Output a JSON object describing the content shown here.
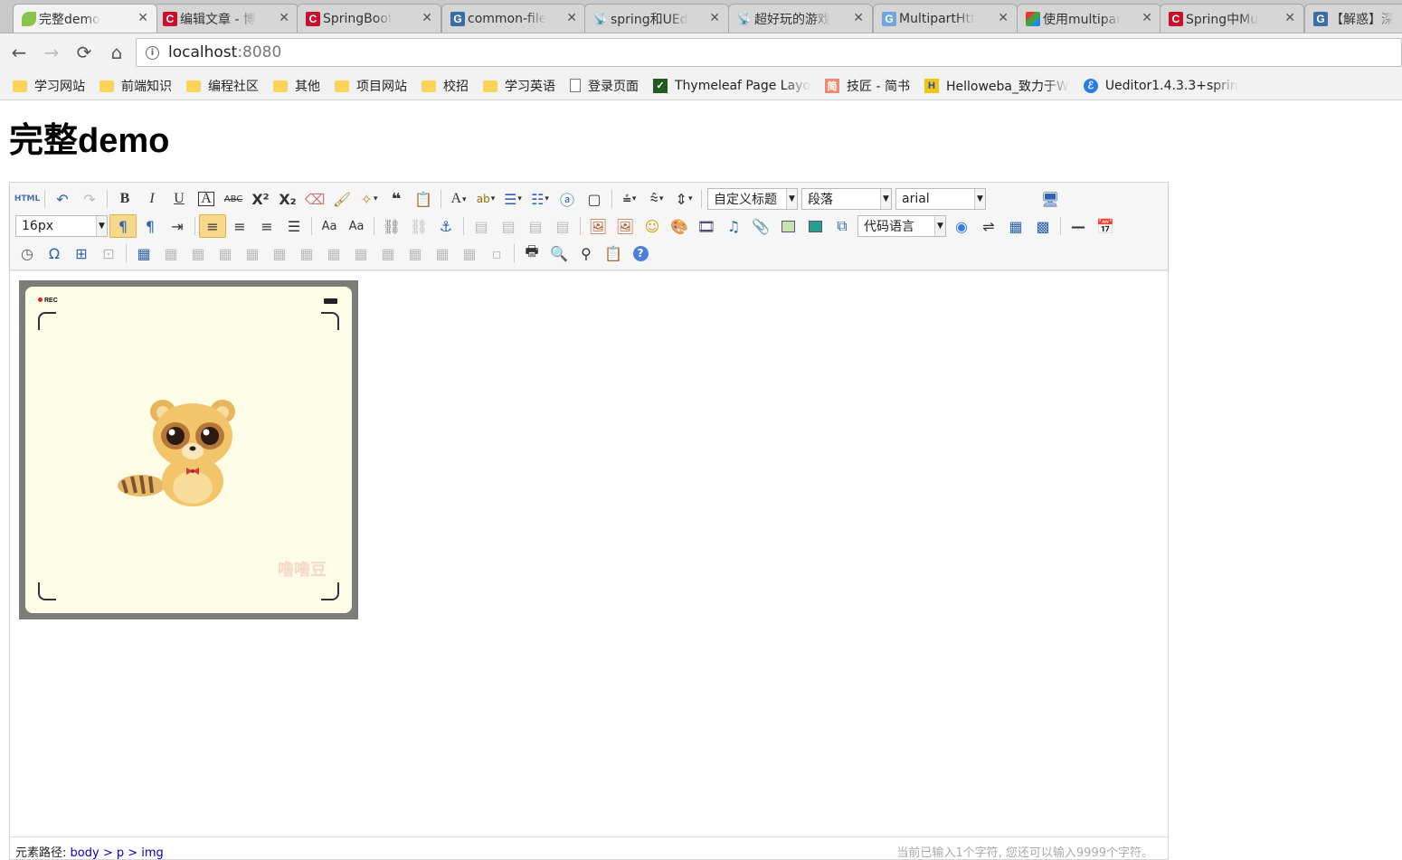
{
  "tabs": [
    {
      "title": "完整demo",
      "icon": "leaf-icon",
      "active": true
    },
    {
      "title": "编辑文章 - 博",
      "icon": "csdn-icon"
    },
    {
      "title": "SpringBoot",
      "icon": "csdn-icon"
    },
    {
      "title": "common-file",
      "icon": "g-icon"
    },
    {
      "title": "spring和UEd",
      "icon": "antenna-icon"
    },
    {
      "title": "超好玩的游戏",
      "icon": "antenna-icon"
    },
    {
      "title": "MultipartHtt",
      "icon": "g-light-icon"
    },
    {
      "title": "使用multipar",
      "icon": "multi-icon"
    },
    {
      "title": "Spring中Mu",
      "icon": "csdn-icon"
    },
    {
      "title": "【解惑】深",
      "icon": "g-icon"
    }
  ],
  "address": {
    "host": "localhost",
    "port": ":8080"
  },
  "bookmarks": [
    {
      "label": "学习网站",
      "icon": "folder-icon"
    },
    {
      "label": "前端知识",
      "icon": "folder-icon"
    },
    {
      "label": "编程社区",
      "icon": "folder-icon"
    },
    {
      "label": "其他",
      "icon": "folder-icon"
    },
    {
      "label": "项目网站",
      "icon": "folder-icon"
    },
    {
      "label": "校招",
      "icon": "folder-icon"
    },
    {
      "label": "学习英语",
      "icon": "folder-icon"
    },
    {
      "label": "登录页面",
      "icon": "page-icon"
    },
    {
      "label": "Thymeleaf Page Layo",
      "icon": "thymeleaf-icon"
    },
    {
      "label": "技匠 - 简书",
      "icon": "jianshu-icon",
      "badge": "简"
    },
    {
      "label": "Helloweba_致力于W",
      "icon": "helloweba-icon",
      "badge": "H"
    },
    {
      "label": "Ueditor1.4.3.3+sprin",
      "icon": "ueditor-icon"
    }
  ],
  "page": {
    "title": "完整demo"
  },
  "toolbar": {
    "fontsize": "16px",
    "heading": "自定义标题",
    "paragraph": "段落",
    "fontfamily": "arial",
    "codelang": "代码语言"
  },
  "editor": {
    "image_labels": {
      "rec": "REC",
      "watermark": "噜噜豆"
    },
    "element_path_label": "元素路径:",
    "element_path": "body > p > img",
    "word_count": "当前已输入1个字符, 您还可以输入9999个字符。"
  },
  "colors": {
    "active_button": "#f8d98c",
    "accent_blue": "#3a6ea5"
  }
}
